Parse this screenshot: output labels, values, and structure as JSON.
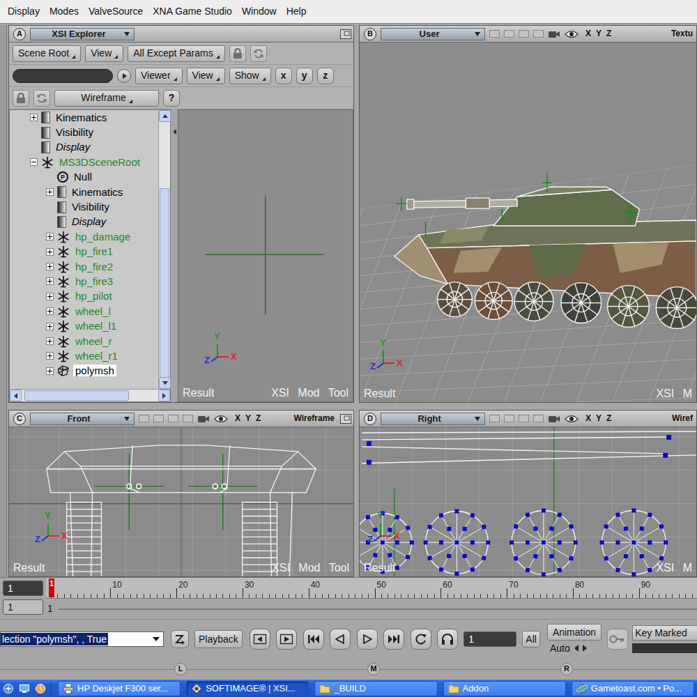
{
  "menu": [
    "Display",
    "Modes",
    "ValveSource",
    "XNA Game Studio",
    "Window",
    "Help"
  ],
  "explorer": {
    "letter": "A",
    "title": "XSI Explorer",
    "toolbar1": [
      "Scene Root",
      "View",
      "All Except Params"
    ],
    "toolbar2": [
      "Viewer",
      "View",
      "Show"
    ],
    "axis_buttons": [
      "x",
      "y",
      "z"
    ],
    "mode": "Wireframe",
    "help": "?",
    "tree": [
      {
        "label": "Kinematics",
        "depth": 1,
        "kind": "property",
        "expandable": true,
        "expanded": false,
        "italic": false,
        "selected": false,
        "color": "#000000"
      },
      {
        "label": "Visibility",
        "depth": 1,
        "kind": "property",
        "expandable": false,
        "expanded": false,
        "italic": false,
        "selected": false,
        "color": "#000000"
      },
      {
        "label": "Display",
        "depth": 1,
        "kind": "property",
        "expandable": false,
        "expanded": false,
        "italic": true,
        "selected": false,
        "color": "#000000"
      },
      {
        "label": "MS3DSceneRoot",
        "depth": 1,
        "kind": "model",
        "expandable": true,
        "expanded": true,
        "italic": false,
        "selected": false,
        "color": "#1f8a1f"
      },
      {
        "label": "Null",
        "depth": 2,
        "kind": "null",
        "icon_text": "P",
        "expandable": false,
        "expanded": false,
        "italic": false,
        "selected": false,
        "color": "#000000"
      },
      {
        "label": "Kinematics",
        "depth": 2,
        "kind": "property",
        "expandable": true,
        "expanded": false,
        "italic": false,
        "selected": false,
        "color": "#000000"
      },
      {
        "label": "Visibility",
        "depth": 2,
        "kind": "property",
        "expandable": false,
        "expanded": false,
        "italic": false,
        "selected": false,
        "color": "#000000"
      },
      {
        "label": "Display",
        "depth": 2,
        "kind": "property",
        "expandable": false,
        "expanded": false,
        "italic": true,
        "selected": false,
        "color": "#000000"
      },
      {
        "label": "hp_damage",
        "depth": 2,
        "kind": "model",
        "expandable": true,
        "expanded": false,
        "italic": false,
        "selected": false,
        "color": "#1f8a1f"
      },
      {
        "label": "hp_fire1",
        "depth": 2,
        "kind": "model",
        "expandable": true,
        "expanded": false,
        "italic": false,
        "selected": false,
        "color": "#1f8a1f"
      },
      {
        "label": "hp_fire2",
        "depth": 2,
        "kind": "model",
        "expandable": true,
        "expanded": false,
        "italic": false,
        "selected": false,
        "color": "#1f8a1f"
      },
      {
        "label": "hp_fire3",
        "depth": 2,
        "kind": "model",
        "expandable": true,
        "expanded": false,
        "italic": false,
        "selected": false,
        "color": "#1f8a1f"
      },
      {
        "label": "hp_pilot",
        "depth": 2,
        "kind": "model",
        "expandable": true,
        "expanded": false,
        "italic": false,
        "selected": false,
        "color": "#1f8a1f"
      },
      {
        "label": "wheel_l",
        "depth": 2,
        "kind": "model",
        "expandable": true,
        "expanded": false,
        "italic": false,
        "selected": false,
        "color": "#1f8a1f"
      },
      {
        "label": "wheel_l1",
        "depth": 2,
        "kind": "model",
        "expandable": true,
        "expanded": false,
        "italic": false,
        "selected": false,
        "color": "#1f8a1f"
      },
      {
        "label": "wheel_r",
        "depth": 2,
        "kind": "model",
        "expandable": true,
        "expanded": false,
        "italic": false,
        "selected": false,
        "color": "#1f8a1f"
      },
      {
        "label": "wheel_r1",
        "depth": 2,
        "kind": "model",
        "expandable": true,
        "expanded": false,
        "italic": false,
        "selected": false,
        "color": "#1f8a1f"
      },
      {
        "label": "polymsh",
        "depth": 2,
        "kind": "mesh",
        "expandable": true,
        "expanded": false,
        "italic": false,
        "selected": true,
        "color": "#000000"
      }
    ],
    "preview": {
      "axis_labels": {
        "y": "Y",
        "z": "Z",
        "x": "X"
      },
      "footer_left": "Result",
      "footer_right": "XSI Mod Tool"
    }
  },
  "viewports": [
    {
      "letter": "B",
      "view": "User",
      "axes": [
        "X",
        "Y",
        "Z"
      ],
      "mode": "Textu",
      "header_cut": true,
      "kind": "perspective",
      "axis_labels": {
        "y": "Y",
        "z": "Z",
        "x": "X"
      },
      "footer_left": "Result",
      "footer_right": "XSI M"
    },
    {
      "letter": "C",
      "view": "Front",
      "axes": [
        "X",
        "Y",
        "Z"
      ],
      "mode": "Wireframe",
      "header_cut": false,
      "kind": "front",
      "axis_labels": {
        "y": "Y",
        "z": "Z",
        "x": "X"
      },
      "footer_left": "Result",
      "footer_right": "XSI Mod Tool"
    },
    {
      "letter": "D",
      "view": "Right",
      "axes": [
        "X",
        "Y",
        "Z"
      ],
      "mode": "Wiref",
      "header_cut": true,
      "kind": "right",
      "axis_labels": {
        "y": "Y",
        "z": "Z",
        "x": "X"
      },
      "footer_left": "Result",
      "footer_right": "XSI M"
    }
  ],
  "timeline": {
    "fields": [
      "1",
      "1"
    ],
    "range_label": "1",
    "cursor": "1",
    "ticks": [
      "10",
      "20",
      "30",
      "40",
      "50",
      "60",
      "70",
      "80",
      "90"
    ]
  },
  "playback": {
    "command": "lection \"polymsh\", , True",
    "playback": "Playback",
    "frame": "1",
    "all": "All",
    "animation": "Animation",
    "auto": "Auto",
    "key": "Key Marked"
  },
  "layouts": [
    "L",
    "M",
    "R"
  ],
  "taskbar": [
    {
      "label": "HP Deskjet F300 ser...",
      "kind": "printer",
      "selected": false
    },
    {
      "label": "SOFTIMAGE® | XSI...",
      "kind": "app",
      "selected": true
    },
    {
      "label": "_BUILD",
      "kind": "folder",
      "selected": false
    },
    {
      "label": "Addon",
      "kind": "folder",
      "selected": false
    },
    {
      "label": "Gametoast.com • Po...",
      "kind": "browser",
      "selected": false
    }
  ]
}
